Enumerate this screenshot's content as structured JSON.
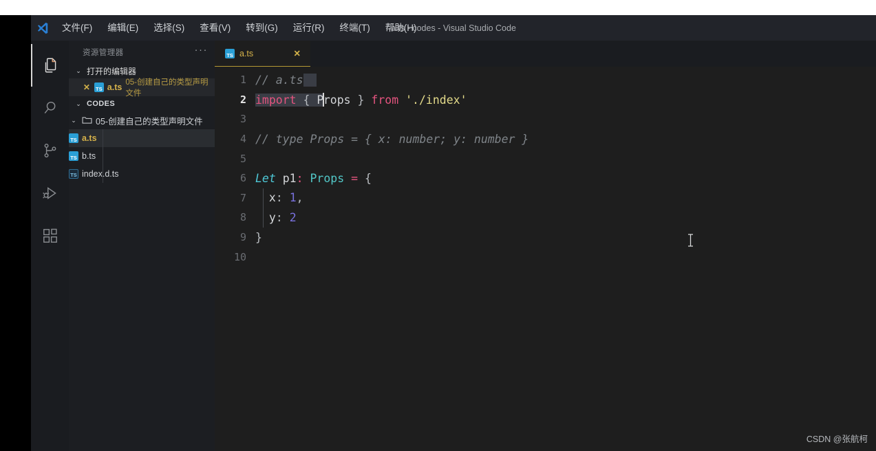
{
  "window": {
    "title": "a.ts - codes - Visual Studio Code",
    "logo_icon": "vscode-logo-icon"
  },
  "menubar": {
    "items": [
      {
        "label": "文件(F)",
        "name": "menu-file"
      },
      {
        "label": "编辑(E)",
        "name": "menu-edit"
      },
      {
        "label": "选择(S)",
        "name": "menu-selection"
      },
      {
        "label": "查看(V)",
        "name": "menu-view"
      },
      {
        "label": "转到(G)",
        "name": "menu-go"
      },
      {
        "label": "运行(R)",
        "name": "menu-run"
      },
      {
        "label": "终端(T)",
        "name": "menu-terminal"
      },
      {
        "label": "帮助(H)",
        "name": "menu-help"
      }
    ]
  },
  "activitybar": {
    "items": [
      {
        "icon": "explorer-files-icon",
        "active": true
      },
      {
        "icon": "search-icon",
        "active": false
      },
      {
        "icon": "source-control-icon",
        "active": false
      },
      {
        "icon": "run-and-debug-icon",
        "active": false
      },
      {
        "icon": "extensions-icon",
        "active": false
      }
    ]
  },
  "sidebar": {
    "title": "资源管理器",
    "more_actions": "···",
    "open_editors": {
      "label": "打开的编辑器",
      "caret": "⌄",
      "items": [
        {
          "close": "✕",
          "icon": "typescript-file-icon",
          "name": "a.ts",
          "description": "05-创建自己的类型声明文件",
          "modified": true
        }
      ]
    },
    "workspace": {
      "label": "CODES",
      "caret": "⌄",
      "folder": {
        "label": "05-创建自己的类型声明文件",
        "caret": "⌄",
        "icon": "folder-open-icon"
      },
      "files": [
        {
          "name": "a.ts",
          "icon": "typescript-file-icon",
          "selected": true,
          "modified": true
        },
        {
          "name": "b.ts",
          "icon": "typescript-file-icon",
          "selected": false,
          "modified": false
        },
        {
          "name": "index.d.ts",
          "icon": "typescript-declaration-file-icon",
          "selected": false,
          "modified": false
        }
      ]
    }
  },
  "editor": {
    "tabs": [
      {
        "label": "a.ts",
        "icon": "typescript-file-icon",
        "close": "✕",
        "active": true,
        "modified": true
      }
    ],
    "active_line": 2,
    "lines": [
      {
        "num": "1",
        "segments": [
          {
            "text": "// a.ts",
            "cls": "t-comment"
          }
        ],
        "selection_tail": true
      },
      {
        "num": "2",
        "segments": [
          {
            "text": "import",
            "cls": "t-kw sel"
          },
          {
            "text": " ",
            "cls": "sel"
          },
          {
            "text": "{",
            "cls": "t-punc sel"
          },
          {
            "text": " ",
            "cls": "sel"
          },
          {
            "text": "P",
            "cls": "t-ident sel"
          },
          {
            "text": "CARET",
            "cls": "caret"
          },
          {
            "text": "rops",
            "cls": "t-ident"
          },
          {
            "text": " ",
            "cls": ""
          },
          {
            "text": "}",
            "cls": "t-punc"
          },
          {
            "text": " ",
            "cls": ""
          },
          {
            "text": "from",
            "cls": "t-kw"
          },
          {
            "text": " ",
            "cls": ""
          },
          {
            "text": "'./index'",
            "cls": "t-string"
          }
        ]
      },
      {
        "num": "3",
        "segments": []
      },
      {
        "num": "4",
        "segments": [
          {
            "text": "// type Props = { x: number; y: number }",
            "cls": "t-comment"
          }
        ]
      },
      {
        "num": "5",
        "segments": []
      },
      {
        "num": "6",
        "segments": [
          {
            "text": "Let",
            "cls": "t-let"
          },
          {
            "text": " ",
            "cls": ""
          },
          {
            "text": "p1",
            "cls": "t-ident"
          },
          {
            "text": ":",
            "cls": "t-colon"
          },
          {
            "text": " ",
            "cls": ""
          },
          {
            "text": "Props",
            "cls": "t-type"
          },
          {
            "text": " ",
            "cls": ""
          },
          {
            "text": "=",
            "cls": "t-op"
          },
          {
            "text": " ",
            "cls": ""
          },
          {
            "text": "{",
            "cls": "t-punc"
          }
        ]
      },
      {
        "num": "7",
        "segments": [
          {
            "text": "  ",
            "cls": ""
          },
          {
            "text": "x",
            "cls": "t-ident"
          },
          {
            "text": ":",
            "cls": "t-punc"
          },
          {
            "text": " ",
            "cls": ""
          },
          {
            "text": "1",
            "cls": "t-num"
          },
          {
            "text": ",",
            "cls": "t-punc"
          }
        ]
      },
      {
        "num": "8",
        "segments": [
          {
            "text": "  ",
            "cls": ""
          },
          {
            "text": "y",
            "cls": "t-ident"
          },
          {
            "text": ":",
            "cls": "t-punc"
          },
          {
            "text": " ",
            "cls": ""
          },
          {
            "text": "2",
            "cls": "t-num"
          }
        ]
      },
      {
        "num": "9",
        "segments": [
          {
            "text": "}",
            "cls": "t-punc"
          }
        ]
      },
      {
        "num": "10",
        "segments": []
      }
    ],
    "mouse_cursor": "text-ibeam-cursor"
  },
  "watermark": {
    "text": "CSDN @张航柯"
  },
  "colors": {
    "accent_modified": "#d6b24a",
    "tab_underline": "#b59a33",
    "titlebar_bg": "#22242a",
    "sidebar_bg": "#1c1e22",
    "editor_bg": "#1e1e1e",
    "activitybar_bg": "#1a1c20",
    "selection_bg": "#3a3d45",
    "keyword": "#e5547f",
    "string": "#e3da8a",
    "type": "#52c7c7",
    "number": "#7a72e0",
    "comment": "#7f8489"
  }
}
